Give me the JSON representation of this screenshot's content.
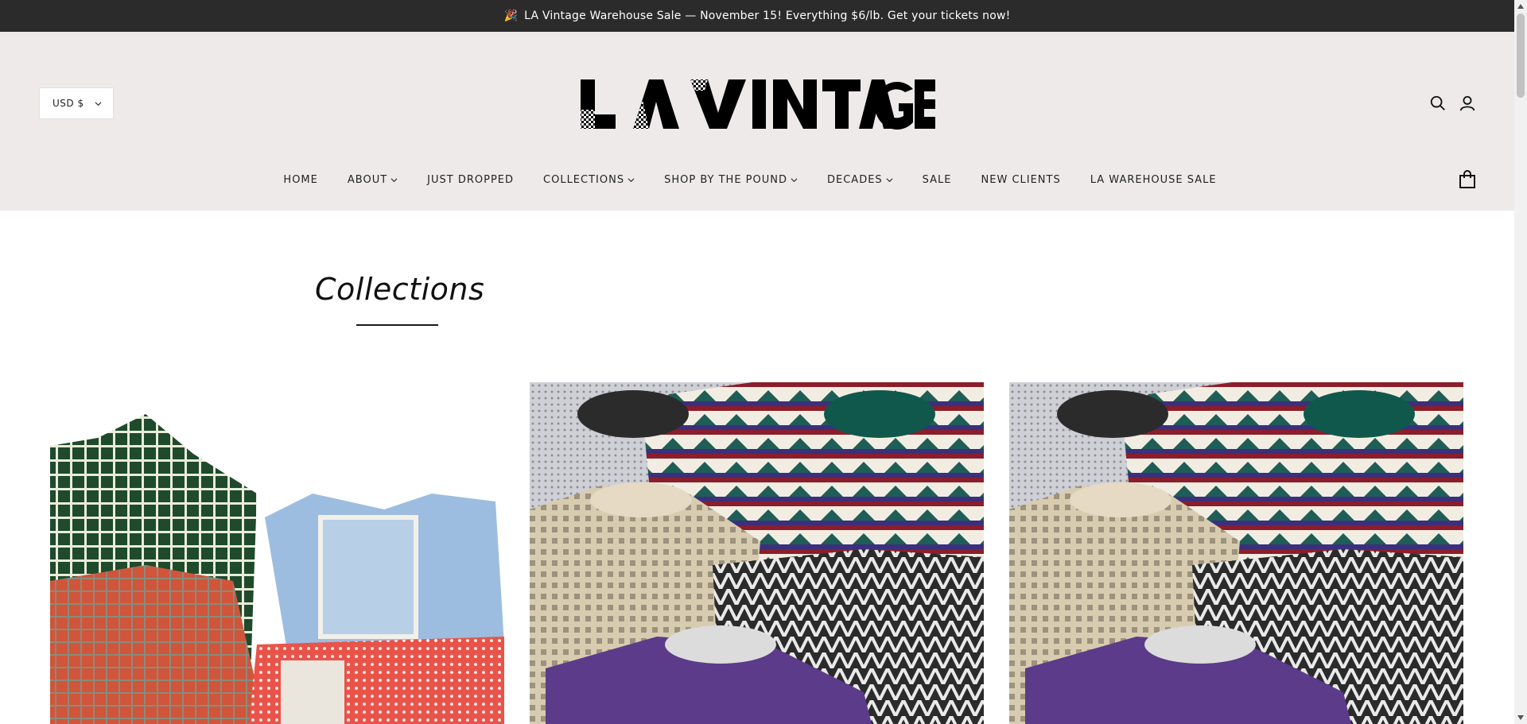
{
  "announcement": {
    "icon": "party-popper-icon",
    "text": "LA Vintage Warehouse Sale — November 15! Everything $6/lb. Get your tickets now!"
  },
  "header": {
    "currency_label": "USD $",
    "logo_text": "LA VINTAGE",
    "icons": [
      "search-icon",
      "account-icon",
      "cart-icon"
    ]
  },
  "nav": {
    "items": [
      {
        "label": "HOME",
        "dropdown": false
      },
      {
        "label": "ABOUT",
        "dropdown": true
      },
      {
        "label": "JUST DROPPED",
        "dropdown": false
      },
      {
        "label": "COLLECTIONS",
        "dropdown": true
      },
      {
        "label": "SHOP BY THE POUND",
        "dropdown": true
      },
      {
        "label": "DECADES",
        "dropdown": true
      },
      {
        "label": "SALE",
        "dropdown": false
      },
      {
        "label": "NEW CLIENTS",
        "dropdown": false
      },
      {
        "label": "LA WAREHOUSE SALE",
        "dropdown": false
      }
    ]
  },
  "main": {
    "title": "Collections",
    "tiles": [
      "vintage-shirts-image",
      "vintage-sweaters-image",
      "vintage-sweaters-image"
    ]
  },
  "colors": {
    "announcement_bg": "#2b2b2b",
    "header_bg": "#eeeaea",
    "text": "#1a1a1a"
  }
}
